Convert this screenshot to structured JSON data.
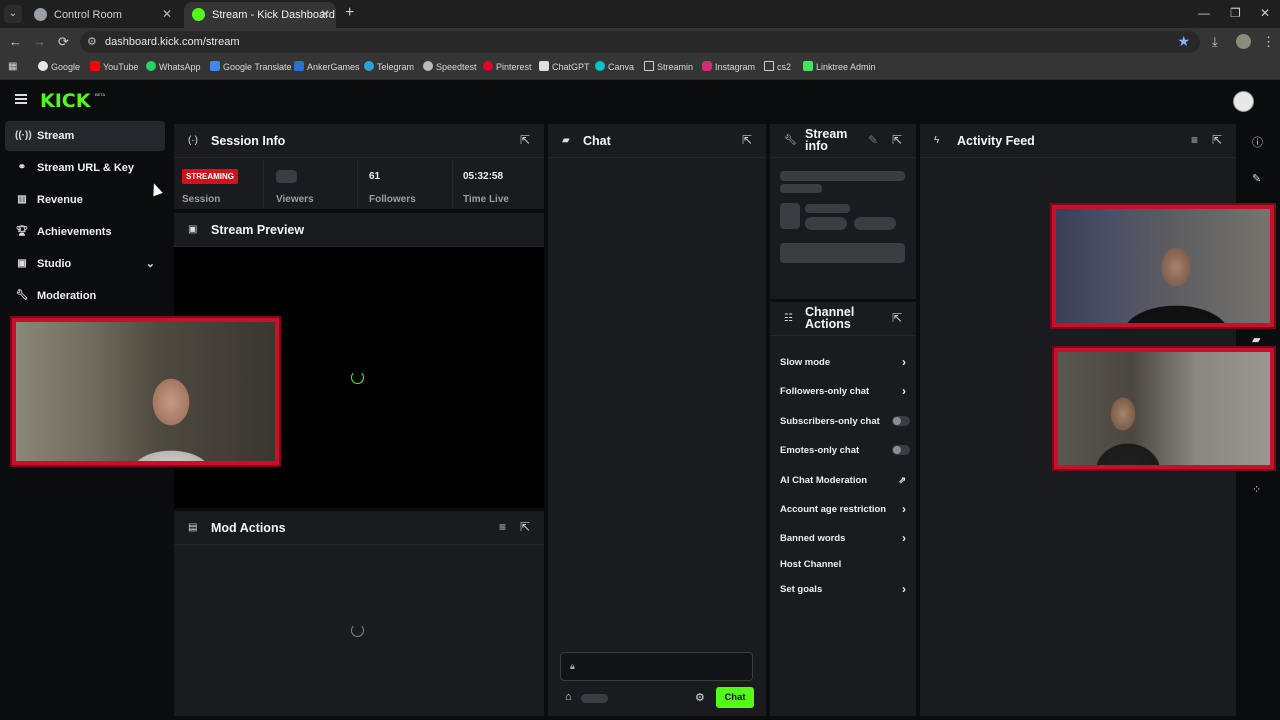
{
  "browser": {
    "tabs": [
      {
        "title": "Control Room",
        "active": false
      },
      {
        "title": "Stream - Kick Dashboard",
        "active": true
      }
    ],
    "url": "dashboard.kick.com/stream",
    "bookmarks": [
      "Google",
      "YouTube",
      "WhatsApp",
      "Google Translate",
      "AnkerGames",
      "Telegram",
      "Speedtest",
      "Pinterest",
      "ChatGPT",
      "Canva",
      "Streamin",
      "Instagram",
      "cs2",
      "Linktree Admin"
    ]
  },
  "app": {
    "logo": "KICK",
    "logo_badge": "BETA"
  },
  "sidebar": {
    "items": [
      {
        "label": "Stream",
        "icon": "broadcast-icon"
      },
      {
        "label": "Stream URL & Key",
        "icon": "link-icon"
      },
      {
        "label": "Revenue",
        "icon": "chart-icon"
      },
      {
        "label": "Achievements",
        "icon": "trophy-icon"
      },
      {
        "label": "Studio",
        "icon": "studio-icon"
      },
      {
        "label": "Moderation",
        "icon": "wrench-icon"
      }
    ]
  },
  "session_info": {
    "title": "Session Info",
    "status_badge": "STREAMING",
    "status_label": "Session",
    "viewers_label": "Viewers",
    "followers_value": "61",
    "followers_label": "Followers",
    "time_live_value": "05:32:58",
    "time_live_label": "Time Live"
  },
  "stream_preview": {
    "title": "Stream Preview"
  },
  "mod_actions": {
    "title": "Mod Actions"
  },
  "chat": {
    "title": "Chat",
    "send_label": "Chat"
  },
  "stream_info": {
    "title": "Stream info"
  },
  "channel_actions": {
    "title": "Channel Actions",
    "items": [
      {
        "label": "Slow mode",
        "control": "arrow"
      },
      {
        "label": "Followers-only chat",
        "control": "arrow"
      },
      {
        "label": "Subscribers-only chat",
        "control": "toggle"
      },
      {
        "label": "Emotes-only chat",
        "control": "toggle"
      },
      {
        "label": "AI Chat Moderation",
        "control": "external"
      },
      {
        "label": "Account age restriction",
        "control": "arrow"
      },
      {
        "label": "Banned words",
        "control": "arrow"
      },
      {
        "label": "Host Channel",
        "control": "none"
      },
      {
        "label": "Set goals",
        "control": "arrow"
      }
    ]
  },
  "activity_feed": {
    "title": "Activity Feed"
  },
  "colors": {
    "accent": "#53fc18",
    "live": "#d4111a",
    "panel": "#191b1f",
    "cam_border": "#c8102e"
  }
}
